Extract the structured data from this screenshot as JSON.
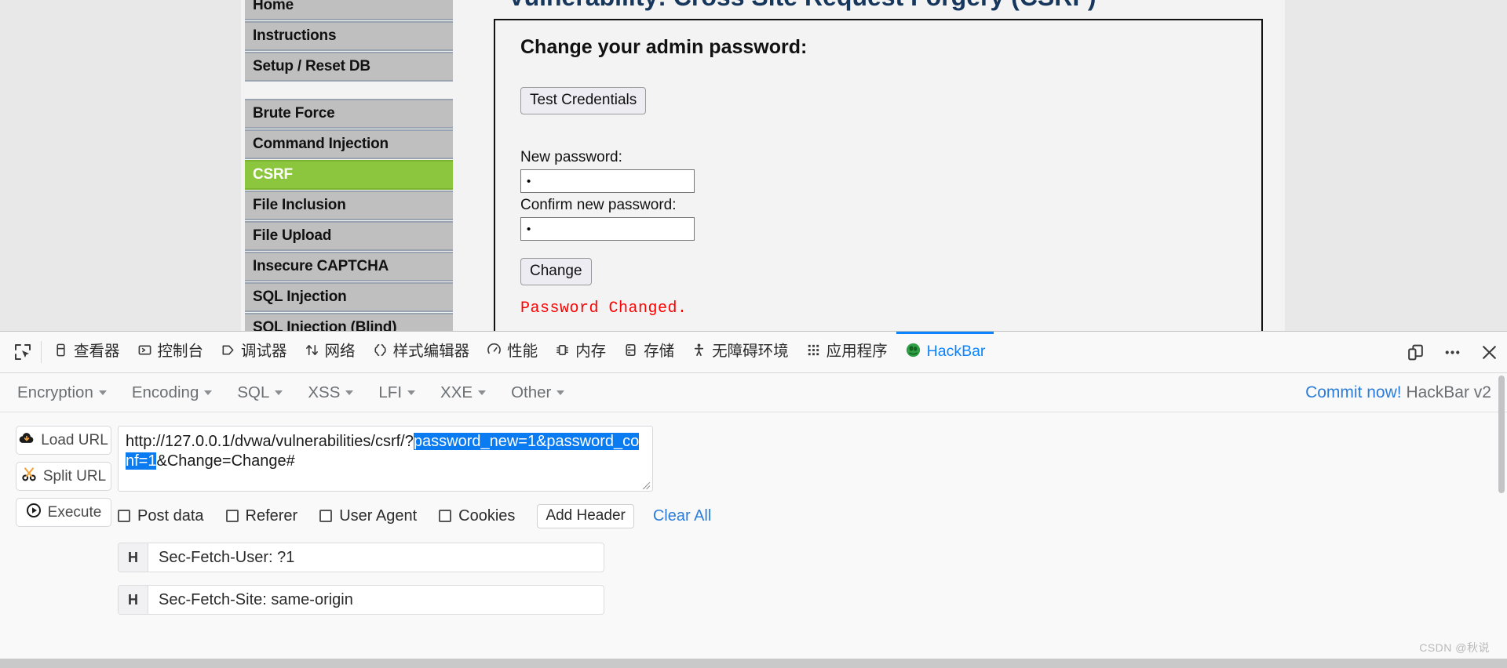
{
  "page": {
    "title": "Vulnerability: Cross Site Request Forgery (CSRF)",
    "sidebar": {
      "group1": [
        {
          "label": "Home",
          "active": false
        },
        {
          "label": "Instructions",
          "active": false
        },
        {
          "label": "Setup / Reset DB",
          "active": false
        }
      ],
      "group2": [
        {
          "label": "Brute Force",
          "active": false
        },
        {
          "label": "Command Injection",
          "active": false
        },
        {
          "label": "CSRF",
          "active": true
        },
        {
          "label": "File Inclusion",
          "active": false
        },
        {
          "label": "File Upload",
          "active": false
        },
        {
          "label": "Insecure CAPTCHA",
          "active": false
        },
        {
          "label": "SQL Injection",
          "active": false
        },
        {
          "label": "SQL Injection (Blind)",
          "active": false
        }
      ],
      "active_color": "#8cc63e"
    },
    "form": {
      "heading": "Change your admin password:",
      "test_credentials_button": "Test Credentials",
      "new_password_label": "New password:",
      "new_password_value": "•",
      "confirm_password_label": "Confirm new password:",
      "confirm_password_value": "•",
      "change_button": "Change",
      "status_message": "Password Changed.",
      "status_color": "#ff0000"
    }
  },
  "devtools": {
    "picker_icon": "element-picker-icon",
    "tabs": [
      {
        "label": "查看器",
        "icon": "inspector-icon",
        "active": false
      },
      {
        "label": "控制台",
        "icon": "console-icon",
        "active": false
      },
      {
        "label": "调试器",
        "icon": "debugger-icon",
        "active": false
      },
      {
        "label": "网络",
        "icon": "network-icon",
        "active": false
      },
      {
        "label": "样式编辑器",
        "icon": "style-editor-icon",
        "active": false
      },
      {
        "label": "性能",
        "icon": "performance-icon",
        "active": false
      },
      {
        "label": "内存",
        "icon": "memory-icon",
        "active": false
      },
      {
        "label": "存储",
        "icon": "storage-icon",
        "active": false
      },
      {
        "label": "无障碍环境",
        "icon": "accessibility-icon",
        "active": false
      },
      {
        "label": "应用程序",
        "icon": "application-icon",
        "active": false
      },
      {
        "label": "HackBar",
        "icon": "hackbar-icon",
        "active": true
      }
    ],
    "active_tab_color": "#0a84ff",
    "right_icons": [
      {
        "name": "dock-layout-icon"
      },
      {
        "name": "meatball-menu-icon"
      },
      {
        "name": "close-icon"
      }
    ]
  },
  "hackbar": {
    "menus": [
      "Encryption",
      "Encoding",
      "SQL",
      "XSS",
      "LFI",
      "XXE",
      "Other"
    ],
    "commit_link": "Commit now!",
    "version_label": "HackBar v2",
    "buttons": [
      {
        "label": "Load URL",
        "icon": "cloud-download-icon"
      },
      {
        "label": "Split URL",
        "icon": "scissors-icon"
      },
      {
        "label": "Execute",
        "icon": "play-icon"
      }
    ],
    "url": {
      "prefix": "http://127.0.0.1/dvwa/vulnerabilities/csrf/?",
      "selected": "password_new=1&password_conf=1",
      "suffix": "&Change=Change#",
      "selection_color": "#0a7bf0"
    },
    "checkboxes": [
      {
        "label": "Post data",
        "checked": false
      },
      {
        "label": "Referer",
        "checked": false
      },
      {
        "label": "User Agent",
        "checked": false
      },
      {
        "label": "Cookies",
        "checked": false
      }
    ],
    "add_header_button": "Add Header",
    "clear_all_link": "Clear All",
    "headers": [
      {
        "tag": "H",
        "value": "Sec-Fetch-User: ?1"
      },
      {
        "tag": "H",
        "value": "Sec-Fetch-Site: same-origin"
      }
    ]
  },
  "watermark": "CSDN @秋说"
}
